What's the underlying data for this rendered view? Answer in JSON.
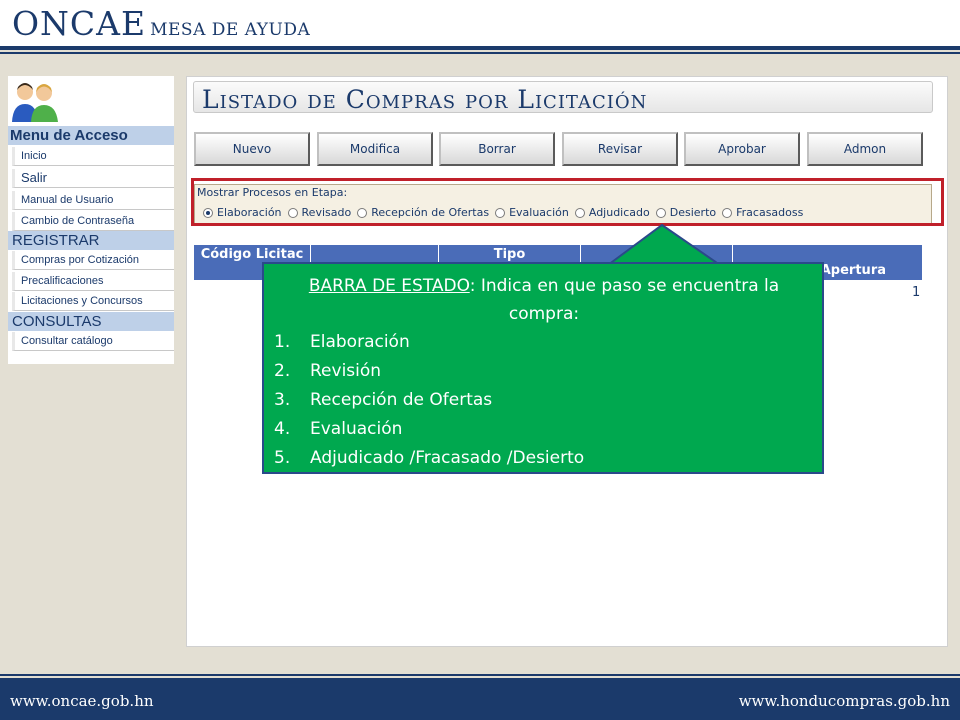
{
  "header": {
    "brand": "ONCAE",
    "subtitle": "MESA DE AYUDA"
  },
  "footer": {
    "left_url": "www.oncae.gob.hn",
    "right_url": "www.honducompras.gob.hn"
  },
  "sidebar": {
    "menu_title": "Menu de Acceso",
    "items_top": [
      "Inicio",
      "Salir",
      "Manual de Usuario",
      "Cambio de Contraseña"
    ],
    "register_title": "REGISTRAR",
    "items_register": [
      "Compras por Cotización",
      "Precalificaciones",
      "Licitaciones y Concursos"
    ],
    "consult_title": "CONSULTAS",
    "items_consult": [
      "Consultar catálogo"
    ]
  },
  "main": {
    "title": "Listado de Compras por Licitación",
    "buttons": [
      "Nuevo",
      "Modifica",
      "Borrar",
      "Revisar",
      "Aprobar",
      "Admon"
    ],
    "filter": {
      "label": "Mostrar Procesos en Etapa:",
      "options": [
        "Elaboración",
        "Revisado",
        "Recepción de Ofertas",
        "Evaluación",
        "Adjudicado",
        "Desierto",
        "Fracasadoss"
      ],
      "selected": "Elaboración"
    },
    "table": {
      "headers": [
        "Código Licitac",
        "Tipo",
        "Apertura"
      ],
      "page": "1"
    }
  },
  "callout": {
    "key": "BARRA DE ESTADO",
    "text": ": Indica en que paso se encuentra la compra:",
    "items": [
      {
        "num": "1.",
        "label": "Elaboración"
      },
      {
        "num": "2.",
        "label": "Revisión"
      },
      {
        "num": "3.",
        "label": "Recepción de Ofertas"
      },
      {
        "num": "4.",
        "label": "Evaluación"
      },
      {
        "num": "5.",
        "label": "Adjudicado /Fracasado /Desierto"
      }
    ]
  },
  "colors": {
    "brand_blue": "#1b3a6b",
    "callout_green": "#00a84f",
    "highlight_red": "#c0202a",
    "table_header": "#4a6cb8"
  }
}
